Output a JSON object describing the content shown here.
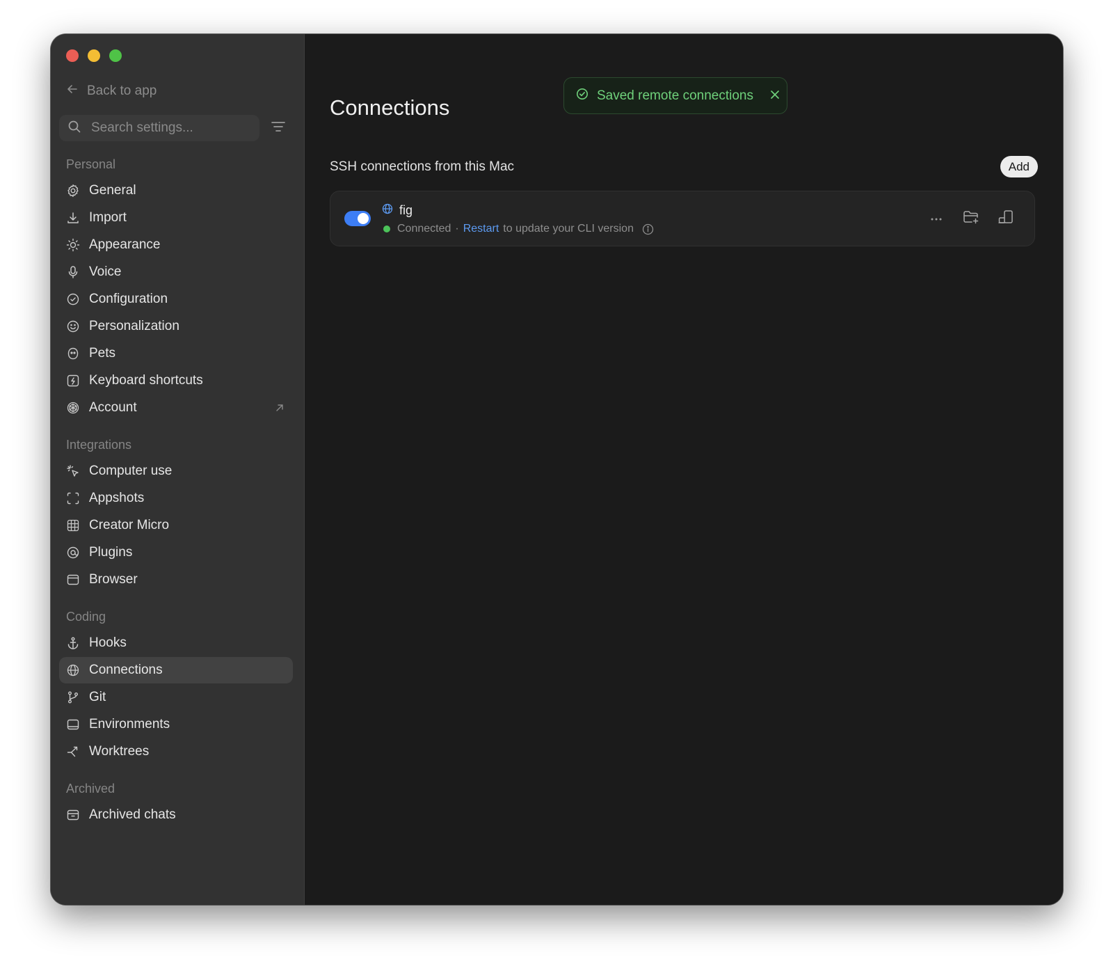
{
  "colors": {
    "close": "#ec5e55",
    "minimize": "#f3bd34",
    "maximize": "#4fc347",
    "accent": "#3d7ef5",
    "link": "#5d9bf2",
    "success": "#6fd17b",
    "status_connected": "#4cc35a"
  },
  "sidebar": {
    "back_label": "Back to app",
    "search_placeholder": "Search settings...",
    "sections": [
      {
        "title": "Personal",
        "items": [
          {
            "label": "General",
            "icon": "gear-icon"
          },
          {
            "label": "Import",
            "icon": "download-icon"
          },
          {
            "label": "Appearance",
            "icon": "sun-icon"
          },
          {
            "label": "Voice",
            "icon": "microphone-icon"
          },
          {
            "label": "Configuration",
            "icon": "shield-icon"
          },
          {
            "label": "Personalization",
            "icon": "smile-icon"
          },
          {
            "label": "Pets",
            "icon": "pet-icon"
          },
          {
            "label": "Keyboard shortcuts",
            "icon": "keyboard-icon"
          },
          {
            "label": "Account",
            "icon": "account-icon",
            "external": true
          }
        ]
      },
      {
        "title": "Integrations",
        "items": [
          {
            "label": "Computer use",
            "icon": "cursor-sparkle-icon"
          },
          {
            "label": "Appshots",
            "icon": "screenshot-icon"
          },
          {
            "label": "Creator Micro",
            "icon": "grid-icon"
          },
          {
            "label": "Plugins",
            "icon": "plugin-icon"
          },
          {
            "label": "Browser",
            "icon": "browser-icon"
          }
        ]
      },
      {
        "title": "Coding",
        "items": [
          {
            "label": "Hooks",
            "icon": "anchor-icon"
          },
          {
            "label": "Connections",
            "icon": "globe-icon",
            "active": true
          },
          {
            "label": "Git",
            "icon": "git-branch-icon"
          },
          {
            "label": "Environments",
            "icon": "monitor-icon"
          },
          {
            "label": "Worktrees",
            "icon": "worktree-icon"
          }
        ]
      },
      {
        "title": "Archived",
        "items": [
          {
            "label": "Archived chats",
            "icon": "archive-icon"
          }
        ]
      }
    ]
  },
  "main": {
    "title": "Connections",
    "toast": {
      "message": "Saved remote connections"
    },
    "section_heading": "SSH connections from this Mac",
    "add_label": "Add",
    "connection": {
      "name": "fig",
      "enabled": true,
      "status": "Connected",
      "separator": "·",
      "restart_label": "Restart",
      "restart_suffix": "to update your CLI version"
    }
  }
}
